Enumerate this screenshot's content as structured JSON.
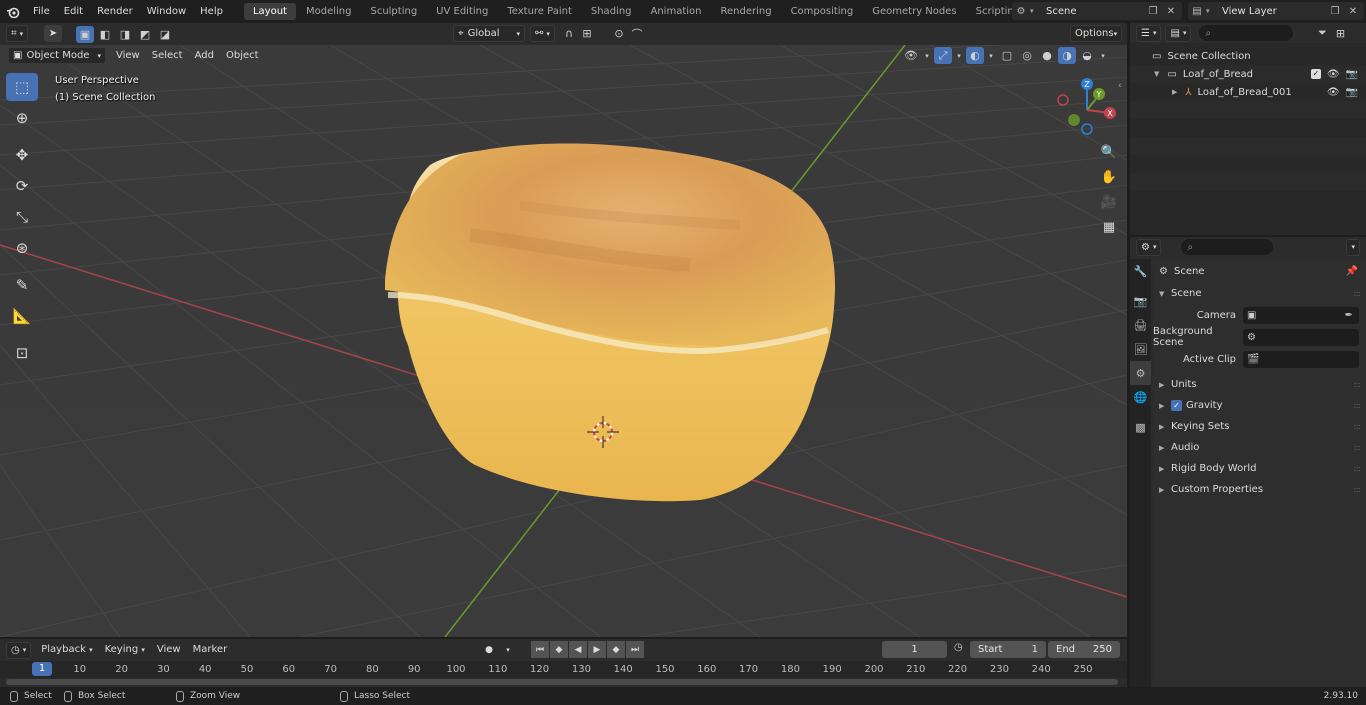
{
  "menubar": {
    "items": [
      "File",
      "Edit",
      "Render",
      "Window",
      "Help"
    ],
    "workspaces": [
      "Layout",
      "Modeling",
      "Sculpting",
      "UV Editing",
      "Texture Paint",
      "Shading",
      "Animation",
      "Rendering",
      "Compositing",
      "Geometry Nodes",
      "Scripting"
    ],
    "active_workspace": "Layout",
    "scene_name": "Scene",
    "view_layer": "View Layer"
  },
  "viewport_header": {
    "mode": "Object Mode",
    "menus": [
      "View",
      "Select",
      "Add",
      "Object"
    ],
    "orientation": "Global",
    "options": "Options"
  },
  "viewport": {
    "perspective_label": "User Perspective",
    "collection_label": "(1) Scene Collection"
  },
  "gizmo_axes": {
    "x": "X",
    "y": "Y",
    "z": "Z"
  },
  "outliner": {
    "root": "Scene Collection",
    "collection": "Loaf_of_Bread",
    "object": "Loaf_of_Bread_001"
  },
  "properties": {
    "context": "Scene",
    "panel_title": "Scene",
    "fields": [
      {
        "label": "Camera",
        "icon": "camera-icon"
      },
      {
        "label": "Background Scene",
        "icon": "scene-icon"
      },
      {
        "label": "Active Clip",
        "icon": "clip-icon"
      }
    ],
    "subpanels": [
      "Units",
      "Gravity",
      "Keying Sets",
      "Audio",
      "Rigid Body World",
      "Custom Properties"
    ],
    "gravity_checked": true
  },
  "timeline": {
    "menus": [
      "Playback",
      "Keying",
      "View",
      "Marker"
    ],
    "current_frame": "1",
    "start_label": "Start",
    "start_value": "1",
    "end_label": "End",
    "end_value": "250",
    "ruler_ticks": [
      "1",
      "10",
      "20",
      "30",
      "40",
      "50",
      "60",
      "70",
      "80",
      "90",
      "100",
      "110",
      "120",
      "130",
      "140",
      "150",
      "160",
      "170",
      "180",
      "190",
      "200",
      "210",
      "220",
      "230",
      "240",
      "250"
    ]
  },
  "statusbar": {
    "select": "Select",
    "box_select": "Box Select",
    "zoom_view": "Zoom View",
    "lasso_select": "Lasso Select",
    "version": "2.93.10"
  },
  "colors": {
    "accent": "#4772b3",
    "x_axis": "#c0434f",
    "y_axis": "#6c9a2a",
    "z_axis": "#2f7fd6",
    "bread_crust": "#c9843f",
    "bread_light": "#efc870"
  }
}
